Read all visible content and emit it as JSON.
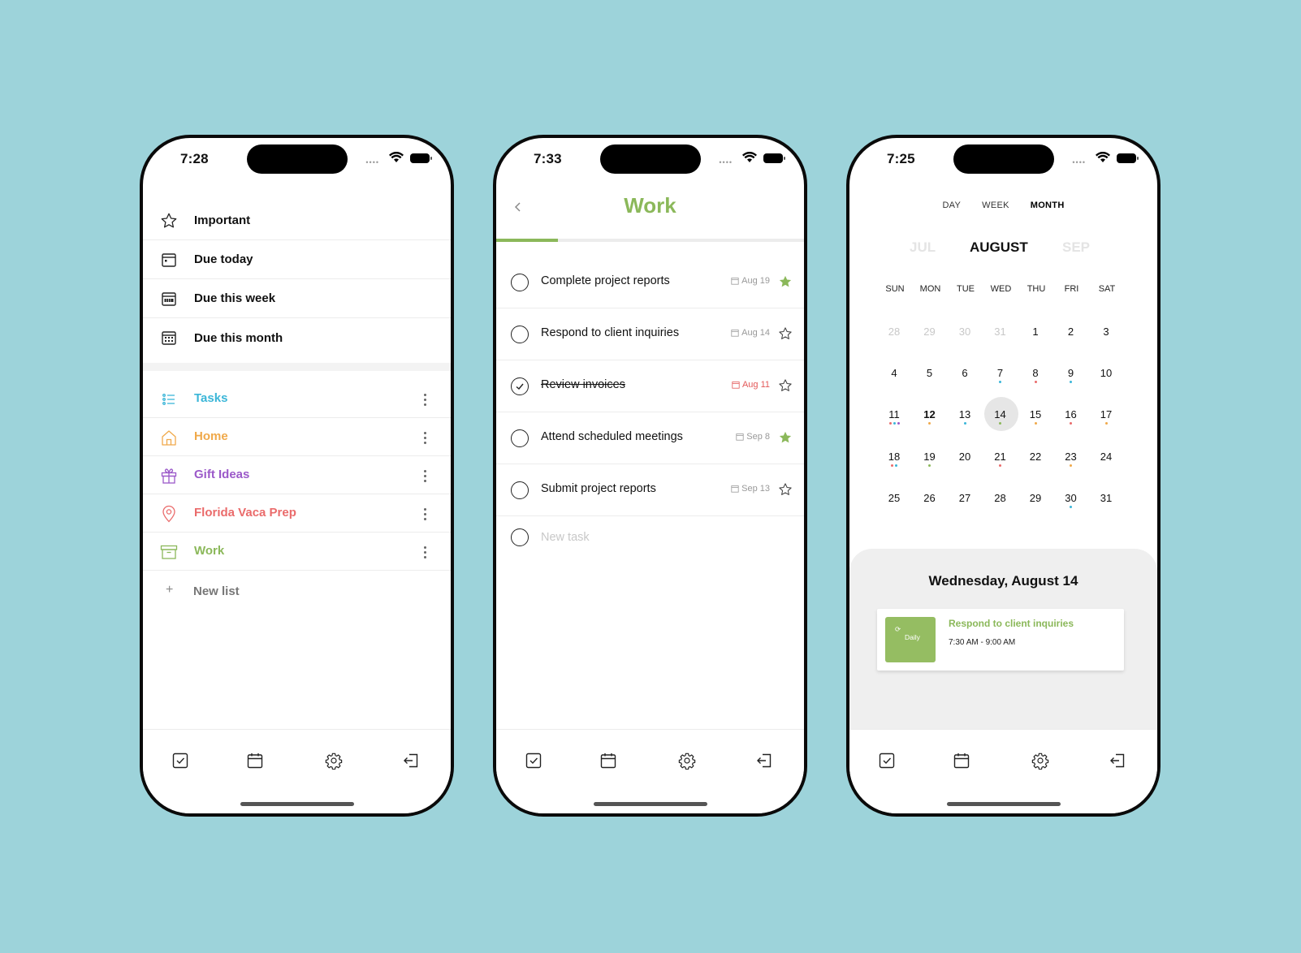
{
  "colors": {
    "background": "#9dd3da",
    "work_green": "#8bb85a",
    "tasks_blue": "#3bb6d8",
    "home_orange": "#f0a94a",
    "gift_purple": "#9b59c9",
    "florida_red": "#ea6b6b",
    "overdue_red": "#e35858",
    "star_green": "#8bb85a"
  },
  "phone1": {
    "time": "7:28",
    "smart_lists": [
      {
        "label": "Important",
        "icon": "star-icon"
      },
      {
        "label": "Due today",
        "icon": "calendar-day-icon"
      },
      {
        "label": "Due this week",
        "icon": "calendar-week-icon"
      },
      {
        "label": "Due this month",
        "icon": "calendar-month-icon"
      }
    ],
    "lists": [
      {
        "label": "Tasks",
        "icon": "list-icon",
        "color": "#3bb6d8"
      },
      {
        "label": "Home",
        "icon": "house-icon",
        "color": "#f0a94a"
      },
      {
        "label": "Gift Ideas",
        "icon": "gift-icon",
        "color": "#9b59c9"
      },
      {
        "label": "Florida Vaca Prep",
        "icon": "location-pin-icon",
        "color": "#ea6b6b"
      },
      {
        "label": "Work",
        "icon": "archive-box-icon",
        "color": "#8bb85a"
      }
    ],
    "new_list_label": "New list",
    "new_list_plus": "+"
  },
  "phone2": {
    "time": "7:33",
    "title": "Work",
    "progress": 0.2,
    "tasks": [
      {
        "title": "Complete project reports",
        "due": "Aug 19",
        "done": false,
        "overdue": false,
        "starred": true
      },
      {
        "title": "Respond to client inquiries",
        "due": "Aug 14",
        "done": false,
        "overdue": false,
        "starred": false
      },
      {
        "title": "Review invoices",
        "due": "Aug 11",
        "done": true,
        "overdue": true,
        "starred": false
      },
      {
        "title": "Attend scheduled meetings",
        "due": "Sep 8",
        "done": false,
        "overdue": false,
        "starred": true
      },
      {
        "title": "Submit project reports",
        "due": "Sep 13",
        "done": false,
        "overdue": false,
        "starred": false
      }
    ],
    "new_task_placeholder": "New task"
  },
  "phone3": {
    "time": "7:25",
    "views": [
      "DAY",
      "WEEK",
      "MONTH"
    ],
    "active_view": "MONTH",
    "months": {
      "prev": "JUL",
      "current": "AUGUST",
      "next": "SEP"
    },
    "weekdays": [
      "SUN",
      "MON",
      "TUE",
      "WED",
      "THU",
      "FRI",
      "SAT"
    ],
    "weeks": [
      [
        {
          "d": "28",
          "other": true
        },
        {
          "d": "29",
          "other": true
        },
        {
          "d": "30",
          "other": true
        },
        {
          "d": "31",
          "other": true
        },
        {
          "d": "1"
        },
        {
          "d": "2"
        },
        {
          "d": "3"
        }
      ],
      [
        {
          "d": "4"
        },
        {
          "d": "5"
        },
        {
          "d": "6"
        },
        {
          "d": "7",
          "dots": [
            "#3bb6d8"
          ]
        },
        {
          "d": "8",
          "dots": [
            "#ea6b6b"
          ]
        },
        {
          "d": "9",
          "dots": [
            "#3bb6d8"
          ]
        },
        {
          "d": "10"
        }
      ],
      [
        {
          "d": "11",
          "dots": [
            "#ea6b6b",
            "#3bb6d8",
            "#9b59c9"
          ]
        },
        {
          "d": "12",
          "bold": true,
          "dots": [
            "#f0a94a"
          ]
        },
        {
          "d": "13",
          "dots": [
            "#3bb6d8"
          ]
        },
        {
          "d": "14",
          "selected": true,
          "dots": [
            "#8bb85a"
          ]
        },
        {
          "d": "15",
          "dots": [
            "#f0a94a"
          ]
        },
        {
          "d": "16",
          "dots": [
            "#ea6b6b"
          ]
        },
        {
          "d": "17",
          "dots": [
            "#f0a94a"
          ]
        }
      ],
      [
        {
          "d": "18",
          "dots": [
            "#ea6b6b",
            "#3bb6d8"
          ]
        },
        {
          "d": "19",
          "dots": [
            "#8bb85a"
          ]
        },
        {
          "d": "20"
        },
        {
          "d": "21",
          "dots": [
            "#ea6b6b"
          ]
        },
        {
          "d": "22"
        },
        {
          "d": "23",
          "dots": [
            "#f0a94a"
          ]
        },
        {
          "d": "24"
        }
      ],
      [
        {
          "d": "25"
        },
        {
          "d": "26"
        },
        {
          "d": "27"
        },
        {
          "d": "28"
        },
        {
          "d": "29"
        },
        {
          "d": "30",
          "dots": [
            "#3bb6d8"
          ]
        },
        {
          "d": "31"
        }
      ]
    ],
    "selected_date_label": "Wednesday, August 14",
    "event": {
      "tag": "Daily",
      "title": "Respond to client inquiries",
      "time": "7:30 AM - 9:00 AM",
      "color": "#95bd62"
    }
  },
  "tabbar": [
    {
      "icon": "checkbox-icon"
    },
    {
      "icon": "calendar-icon"
    },
    {
      "icon": "gear-icon"
    },
    {
      "icon": "logout-icon"
    }
  ]
}
